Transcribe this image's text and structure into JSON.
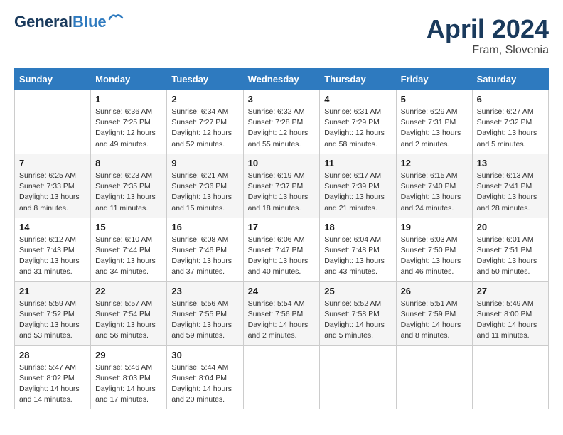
{
  "header": {
    "logo_line1": "General",
    "logo_line2": "Blue",
    "month_year": "April 2024",
    "location": "Fram, Slovenia"
  },
  "weekdays": [
    "Sunday",
    "Monday",
    "Tuesday",
    "Wednesday",
    "Thursday",
    "Friday",
    "Saturday"
  ],
  "weeks": [
    [
      {
        "day": "",
        "info": ""
      },
      {
        "day": "1",
        "info": "Sunrise: 6:36 AM\nSunset: 7:25 PM\nDaylight: 12 hours\nand 49 minutes."
      },
      {
        "day": "2",
        "info": "Sunrise: 6:34 AM\nSunset: 7:27 PM\nDaylight: 12 hours\nand 52 minutes."
      },
      {
        "day": "3",
        "info": "Sunrise: 6:32 AM\nSunset: 7:28 PM\nDaylight: 12 hours\nand 55 minutes."
      },
      {
        "day": "4",
        "info": "Sunrise: 6:31 AM\nSunset: 7:29 PM\nDaylight: 12 hours\nand 58 minutes."
      },
      {
        "day": "5",
        "info": "Sunrise: 6:29 AM\nSunset: 7:31 PM\nDaylight: 13 hours\nand 2 minutes."
      },
      {
        "day": "6",
        "info": "Sunrise: 6:27 AM\nSunset: 7:32 PM\nDaylight: 13 hours\nand 5 minutes."
      }
    ],
    [
      {
        "day": "7",
        "info": "Sunrise: 6:25 AM\nSunset: 7:33 PM\nDaylight: 13 hours\nand 8 minutes."
      },
      {
        "day": "8",
        "info": "Sunrise: 6:23 AM\nSunset: 7:35 PM\nDaylight: 13 hours\nand 11 minutes."
      },
      {
        "day": "9",
        "info": "Sunrise: 6:21 AM\nSunset: 7:36 PM\nDaylight: 13 hours\nand 15 minutes."
      },
      {
        "day": "10",
        "info": "Sunrise: 6:19 AM\nSunset: 7:37 PM\nDaylight: 13 hours\nand 18 minutes."
      },
      {
        "day": "11",
        "info": "Sunrise: 6:17 AM\nSunset: 7:39 PM\nDaylight: 13 hours\nand 21 minutes."
      },
      {
        "day": "12",
        "info": "Sunrise: 6:15 AM\nSunset: 7:40 PM\nDaylight: 13 hours\nand 24 minutes."
      },
      {
        "day": "13",
        "info": "Sunrise: 6:13 AM\nSunset: 7:41 PM\nDaylight: 13 hours\nand 28 minutes."
      }
    ],
    [
      {
        "day": "14",
        "info": "Sunrise: 6:12 AM\nSunset: 7:43 PM\nDaylight: 13 hours\nand 31 minutes."
      },
      {
        "day": "15",
        "info": "Sunrise: 6:10 AM\nSunset: 7:44 PM\nDaylight: 13 hours\nand 34 minutes."
      },
      {
        "day": "16",
        "info": "Sunrise: 6:08 AM\nSunset: 7:46 PM\nDaylight: 13 hours\nand 37 minutes."
      },
      {
        "day": "17",
        "info": "Sunrise: 6:06 AM\nSunset: 7:47 PM\nDaylight: 13 hours\nand 40 minutes."
      },
      {
        "day": "18",
        "info": "Sunrise: 6:04 AM\nSunset: 7:48 PM\nDaylight: 13 hours\nand 43 minutes."
      },
      {
        "day": "19",
        "info": "Sunrise: 6:03 AM\nSunset: 7:50 PM\nDaylight: 13 hours\nand 46 minutes."
      },
      {
        "day": "20",
        "info": "Sunrise: 6:01 AM\nSunset: 7:51 PM\nDaylight: 13 hours\nand 50 minutes."
      }
    ],
    [
      {
        "day": "21",
        "info": "Sunrise: 5:59 AM\nSunset: 7:52 PM\nDaylight: 13 hours\nand 53 minutes."
      },
      {
        "day": "22",
        "info": "Sunrise: 5:57 AM\nSunset: 7:54 PM\nDaylight: 13 hours\nand 56 minutes."
      },
      {
        "day": "23",
        "info": "Sunrise: 5:56 AM\nSunset: 7:55 PM\nDaylight: 13 hours\nand 59 minutes."
      },
      {
        "day": "24",
        "info": "Sunrise: 5:54 AM\nSunset: 7:56 PM\nDaylight: 14 hours\nand 2 minutes."
      },
      {
        "day": "25",
        "info": "Sunrise: 5:52 AM\nSunset: 7:58 PM\nDaylight: 14 hours\nand 5 minutes."
      },
      {
        "day": "26",
        "info": "Sunrise: 5:51 AM\nSunset: 7:59 PM\nDaylight: 14 hours\nand 8 minutes."
      },
      {
        "day": "27",
        "info": "Sunrise: 5:49 AM\nSunset: 8:00 PM\nDaylight: 14 hours\nand 11 minutes."
      }
    ],
    [
      {
        "day": "28",
        "info": "Sunrise: 5:47 AM\nSunset: 8:02 PM\nDaylight: 14 hours\nand 14 minutes."
      },
      {
        "day": "29",
        "info": "Sunrise: 5:46 AM\nSunset: 8:03 PM\nDaylight: 14 hours\nand 17 minutes."
      },
      {
        "day": "30",
        "info": "Sunrise: 5:44 AM\nSunset: 8:04 PM\nDaylight: 14 hours\nand 20 minutes."
      },
      {
        "day": "",
        "info": ""
      },
      {
        "day": "",
        "info": ""
      },
      {
        "day": "",
        "info": ""
      },
      {
        "day": "",
        "info": ""
      }
    ]
  ]
}
